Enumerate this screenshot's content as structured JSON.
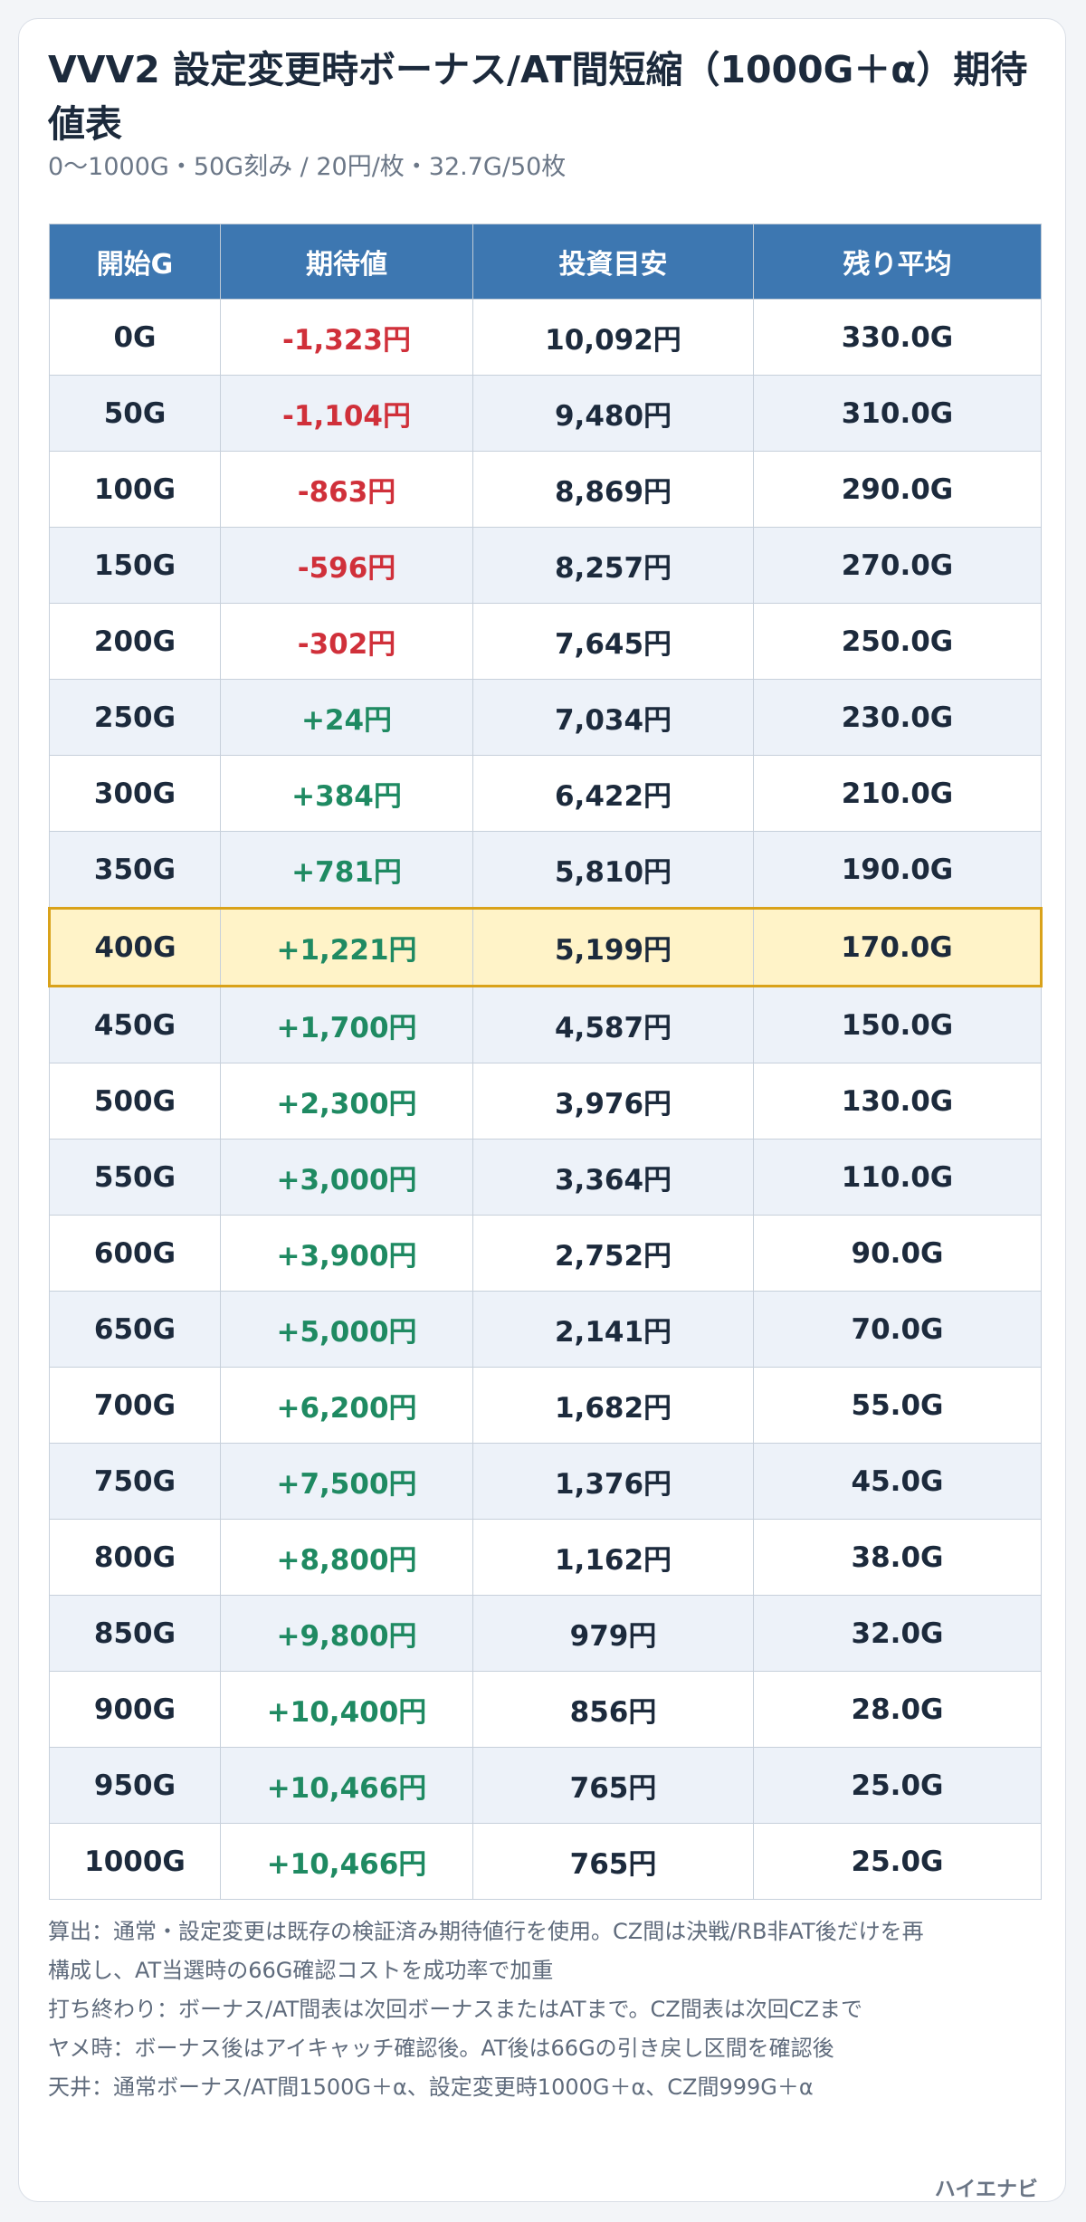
{
  "header": {
    "title": "VVV2 設定変更時ボーナス/AT間短縮（1000G＋α）期待値表",
    "subtitle": "0〜1000G・50G刻み / 20円/枚・32.7G/50枚"
  },
  "table": {
    "headers": [
      "開始G",
      "期待値",
      "投資目安",
      "残り平均"
    ],
    "highlight_row": "400G",
    "rows": [
      {
        "start": "0G",
        "ev": "-1,323円",
        "ev_sign": "neg",
        "invest": "10,092円",
        "remain": "330.0G"
      },
      {
        "start": "50G",
        "ev": "-1,104円",
        "ev_sign": "neg",
        "invest": "9,480円",
        "remain": "310.0G"
      },
      {
        "start": "100G",
        "ev": "-863円",
        "ev_sign": "neg",
        "invest": "8,869円",
        "remain": "290.0G"
      },
      {
        "start": "150G",
        "ev": "-596円",
        "ev_sign": "neg",
        "invest": "8,257円",
        "remain": "270.0G"
      },
      {
        "start": "200G",
        "ev": "-302円",
        "ev_sign": "neg",
        "invest": "7,645円",
        "remain": "250.0G"
      },
      {
        "start": "250G",
        "ev": "+24円",
        "ev_sign": "pos",
        "invest": "7,034円",
        "remain": "230.0G"
      },
      {
        "start": "300G",
        "ev": "+384円",
        "ev_sign": "pos",
        "invest": "6,422円",
        "remain": "210.0G"
      },
      {
        "start": "350G",
        "ev": "+781円",
        "ev_sign": "pos",
        "invest": "5,810円",
        "remain": "190.0G"
      },
      {
        "start": "400G",
        "ev": "+1,221円",
        "ev_sign": "pos",
        "invest": "5,199円",
        "remain": "170.0G"
      },
      {
        "start": "450G",
        "ev": "+1,700円",
        "ev_sign": "pos",
        "invest": "4,587円",
        "remain": "150.0G"
      },
      {
        "start": "500G",
        "ev": "+2,300円",
        "ev_sign": "pos",
        "invest": "3,976円",
        "remain": "130.0G"
      },
      {
        "start": "550G",
        "ev": "+3,000円",
        "ev_sign": "pos",
        "invest": "3,364円",
        "remain": "110.0G"
      },
      {
        "start": "600G",
        "ev": "+3,900円",
        "ev_sign": "pos",
        "invest": "2,752円",
        "remain": "90.0G"
      },
      {
        "start": "650G",
        "ev": "+5,000円",
        "ev_sign": "pos",
        "invest": "2,141円",
        "remain": "70.0G"
      },
      {
        "start": "700G",
        "ev": "+6,200円",
        "ev_sign": "pos",
        "invest": "1,682円",
        "remain": "55.0G"
      },
      {
        "start": "750G",
        "ev": "+7,500円",
        "ev_sign": "pos",
        "invest": "1,376円",
        "remain": "45.0G"
      },
      {
        "start": "800G",
        "ev": "+8,800円",
        "ev_sign": "pos",
        "invest": "1,162円",
        "remain": "38.0G"
      },
      {
        "start": "850G",
        "ev": "+9,800円",
        "ev_sign": "pos",
        "invest": "979円",
        "remain": "32.0G"
      },
      {
        "start": "900G",
        "ev": "+10,400円",
        "ev_sign": "pos",
        "invest": "856円",
        "remain": "28.0G"
      },
      {
        "start": "950G",
        "ev": "+10,466円",
        "ev_sign": "pos",
        "invest": "765円",
        "remain": "25.0G"
      },
      {
        "start": "1000G",
        "ev": "+10,466円",
        "ev_sign": "pos",
        "invest": "765円",
        "remain": "25.0G"
      }
    ]
  },
  "notes": [
    "算出：通常・設定変更は既存の検証済み期待値行を使用。CZ間は決戦/RB非AT後だけを再",
    "構成し、AT当選時の66G確認コストを成功率で加重",
    "打ち終わり：ボーナス/AT間表は次回ボーナスまたはATまで。CZ間表は次回CZまで",
    "ヤメ時：ボーナス後はアイキャッチ確認後。AT後は66Gの引き戻し区間を確認後",
    "天井：通常ボーナス/AT間1500G＋α、設定変更時1000G＋α、CZ間999G＋α"
  ],
  "footer": {
    "brand": "ハイエナビ"
  },
  "colors": {
    "header_bg": "#3d77b1",
    "negative": "#d0303a",
    "positive": "#1f8a62",
    "highlight_bg": "#fff3c8",
    "highlight_border": "#d9a21a",
    "stripe": "#edf2f9"
  }
}
